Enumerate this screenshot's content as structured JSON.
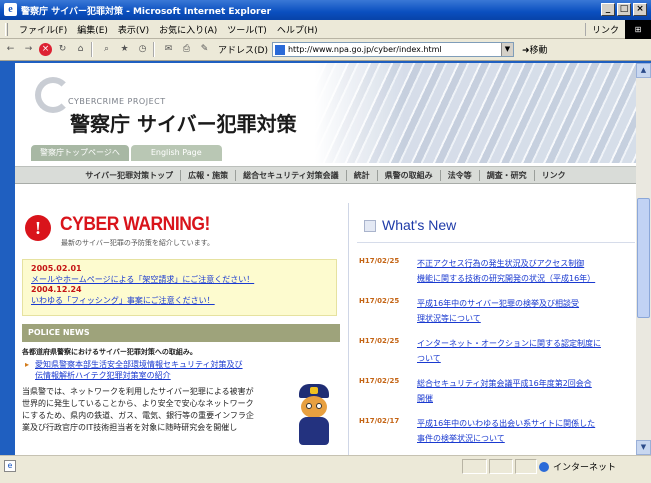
{
  "window": {
    "title": "警察庁 サイバー犯罪対策 - Microsoft Internet Explorer",
    "controls": [
      "_",
      "□",
      "×"
    ]
  },
  "menubar": {
    "items": [
      "ファイル(F)",
      "編集(E)",
      "表示(V)",
      "お気に入り(A)",
      "ツール(T)",
      "ヘルプ(H)"
    ],
    "links_label": "リンク"
  },
  "toolbar": {
    "address_label": "アドレス(D)",
    "address_value": "http://www.npa.go.jp/cyber/index.html",
    "go_label": "移動"
  },
  "statusbar": {
    "zone_label": "インターネット"
  },
  "page": {
    "header": {
      "logo_en": "CYBERCRIME PROJECT",
      "logo_jp": "警察庁 サイバー犯罪対策",
      "tabs": [
        "警察庁トップページへ",
        "English Page"
      ]
    },
    "nav": [
      "サイバー犯罪対策トップ",
      "広報・施策",
      "総合セキュリティ対策会議",
      "統計",
      "県警の取組み",
      "法令等",
      "調査・研究",
      "リンク"
    ],
    "warning": {
      "icon_glyph": "!",
      "title": "CYBER WARNING!",
      "subtitle": "最新のサイバー犯罪の予防策を紹介しています。",
      "items": [
        {
          "date": "2005.02.01",
          "text": "メールやホームページによる「架空請求」にご注意ください！"
        },
        {
          "date": "2004.12.24",
          "text": "いわゆる「フィッシング」事案にご注意ください！"
        }
      ]
    },
    "police_news": {
      "heading": "POLICE NEWS",
      "subheading": "各都道府県警察におけるサイバー犯罪対策への取組み。",
      "links": [
        {
          "line1": "愛知県警察本部生活安全部環境情報セキュリティ対策及び",
          "line2": "伝情報解析ハイテク犯罪対策室の紹介"
        }
      ],
      "body": [
        "当県警では、ネットワークを利用したサイバー犯罪による被害が",
        "世界的に発生していることから、より安全で安心なネットワーク",
        "にするため、県内の鉄道、ガス、電気、銀行等の重要インフラ企",
        "業及び行政官庁のIT技術担当者を対象に随時研究会を開催し"
      ]
    },
    "whats_new": {
      "heading": "What's New",
      "items": [
        {
          "date": "H17/02/25",
          "line1": "不正アクセス行為の発生状況及びアクセス制御",
          "line2": "機能に関する技術の研究開発の状況（平成16年）"
        },
        {
          "date": "H17/02/25",
          "line1": "平成16年中のサイバー犯罪の検挙及び相談受",
          "line2": "理状況等について"
        },
        {
          "date": "H17/02/25",
          "line1": "インターネット・オークションに関する認定制度に",
          "line2": "ついて"
        },
        {
          "date": "H17/02/25",
          "line1": "総合セキュリティ対策会議平成16年度第2回会合",
          "line2": "開催"
        },
        {
          "date": "H17/02/17",
          "line1": "平成16年中のいわゆる出会い系サイトに関係した",
          "line2": "事件の検挙状況について"
        }
      ]
    }
  }
}
